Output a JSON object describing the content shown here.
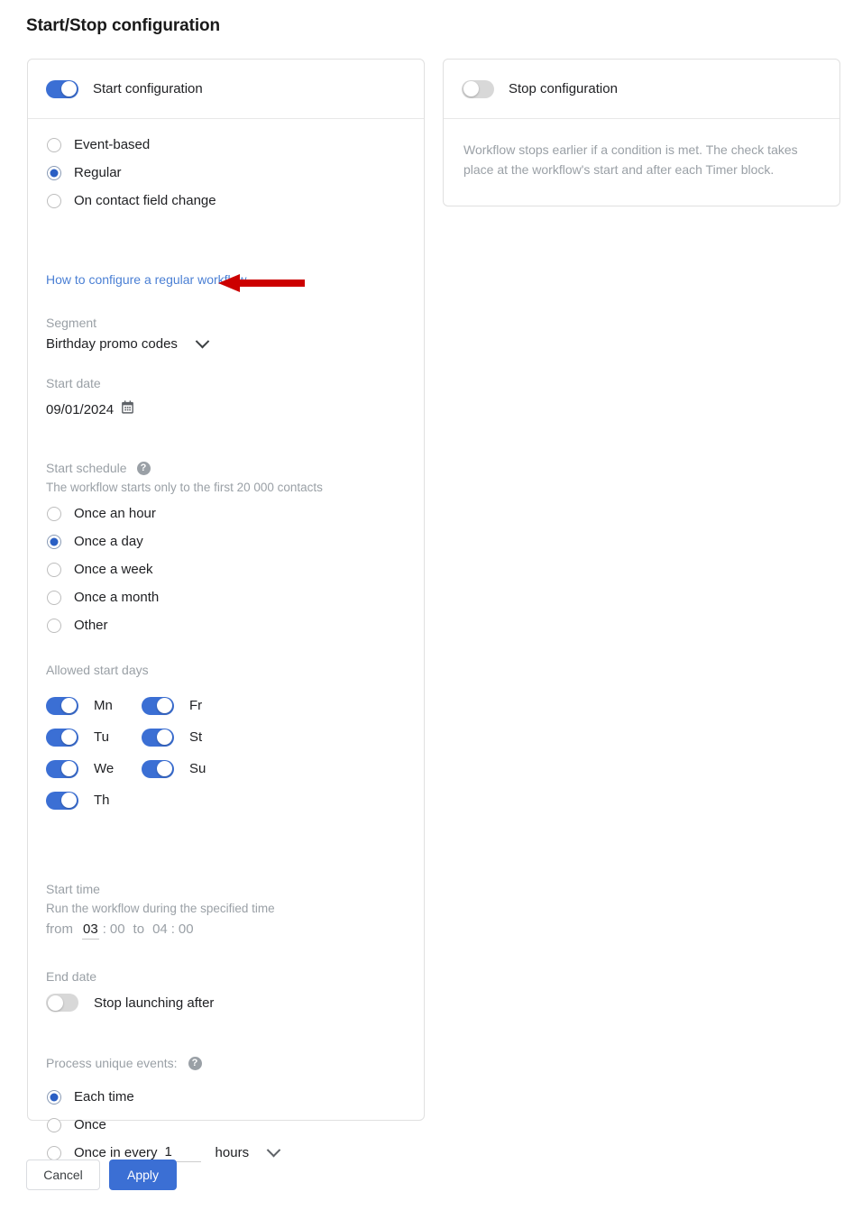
{
  "page_title": "Start/Stop configuration",
  "colors": {
    "accent_blue": "#3b6fd4",
    "link_blue": "#4a7fd4",
    "muted_gray": "#9aa0a6",
    "annotation_red": "#cc0000"
  },
  "start_card": {
    "toggle_label": "Start configuration",
    "toggle_on": true,
    "trigger_options": [
      {
        "label": "Event-based",
        "selected": false
      },
      {
        "label": "Regular",
        "selected": true
      },
      {
        "label": "On contact field change",
        "selected": false
      }
    ],
    "help_link": "How to configure a regular workflow",
    "segment": {
      "label": "Segment",
      "value": "Birthday promo codes"
    },
    "start_date": {
      "label": "Start date",
      "value": "09/01/2024"
    },
    "start_schedule": {
      "label": "Start schedule",
      "note": "The workflow starts only to the first 20 000 contacts",
      "options": [
        {
          "label": "Once an hour",
          "selected": false
        },
        {
          "label": "Once a day",
          "selected": true
        },
        {
          "label": "Once a week",
          "selected": false
        },
        {
          "label": "Once a month",
          "selected": false
        },
        {
          "label": "Other",
          "selected": false
        }
      ]
    },
    "allowed_start_days": {
      "label": "Allowed start days",
      "column_one": [
        {
          "label": "Mn",
          "on": true
        },
        {
          "label": "Tu",
          "on": true
        },
        {
          "label": "We",
          "on": true
        },
        {
          "label": "Th",
          "on": true
        }
      ],
      "column_two": [
        {
          "label": "Fr",
          "on": true
        },
        {
          "label": "St",
          "on": true
        },
        {
          "label": "Su",
          "on": true
        }
      ]
    },
    "start_time": {
      "label": "Start time",
      "note": "Run the workflow during the specified time",
      "from_word": "from",
      "from_hour": "03",
      "from_minute": "00",
      "to_word": "to",
      "to_hour": "04",
      "to_minute": "00",
      "colon": ":"
    },
    "end_date": {
      "label": "End date",
      "toggle_label": "Stop launching after",
      "toggle_on": false
    },
    "process_unique_events": {
      "label": "Process unique events:",
      "options": [
        {
          "label": "Each time",
          "selected": true
        },
        {
          "label": "Once",
          "selected": false
        },
        {
          "label": "Once in every",
          "selected": false
        }
      ],
      "interval_value": "1",
      "interval_unit": "hours"
    }
  },
  "stop_card": {
    "toggle_label": "Stop configuration",
    "toggle_on": false,
    "description": "Workflow stops earlier if a condition is met. The check takes place at the workflow's start and after each Timer block."
  },
  "footer": {
    "cancel_label": "Cancel",
    "apply_label": "Apply"
  }
}
